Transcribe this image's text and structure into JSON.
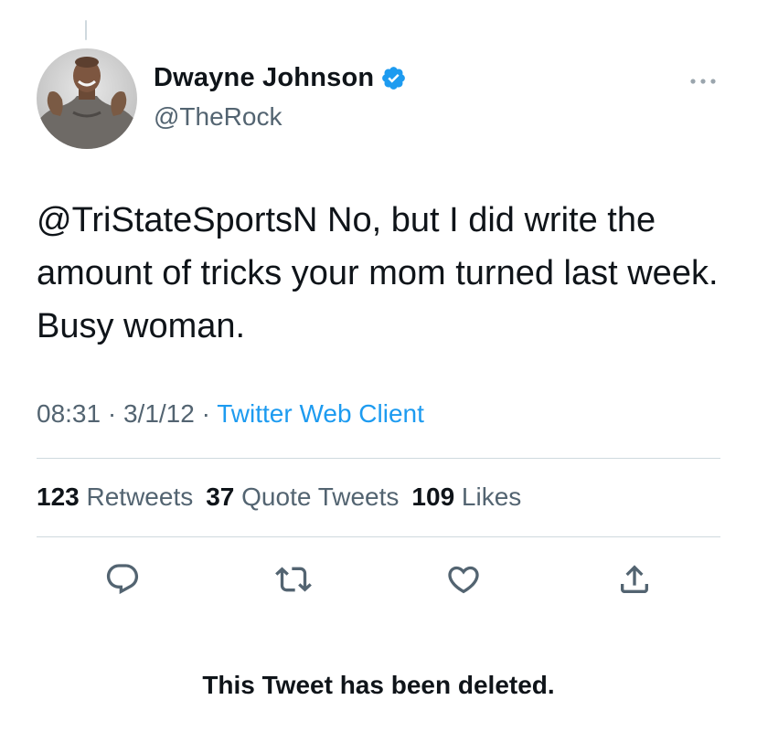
{
  "tweet": {
    "author": {
      "display_name": "Dwayne Johnson",
      "handle": "@TheRock",
      "verified": true,
      "avatar_icon": "profile-photo"
    },
    "text": "@TriStateSportsN No, but I did write the amount of tricks your mom turned last week. Busy woman.",
    "time": "08:31",
    "date": "3/1/12",
    "separator": "·",
    "source": "Twitter Web Client",
    "stats": {
      "retweets_count": "123",
      "retweets_label": "Retweets",
      "quotes_count": "37",
      "quotes_label": "Quote Tweets",
      "likes_count": "109",
      "likes_label": "Likes"
    },
    "actions": [
      "reply-icon",
      "retweet-icon",
      "like-icon",
      "share-icon"
    ],
    "deleted_notice": "This Tweet has been deleted."
  },
  "colors": {
    "text": "#0f1419",
    "secondary": "#536471",
    "accent": "#1d9bf0",
    "divider": "#cfd9de"
  }
}
